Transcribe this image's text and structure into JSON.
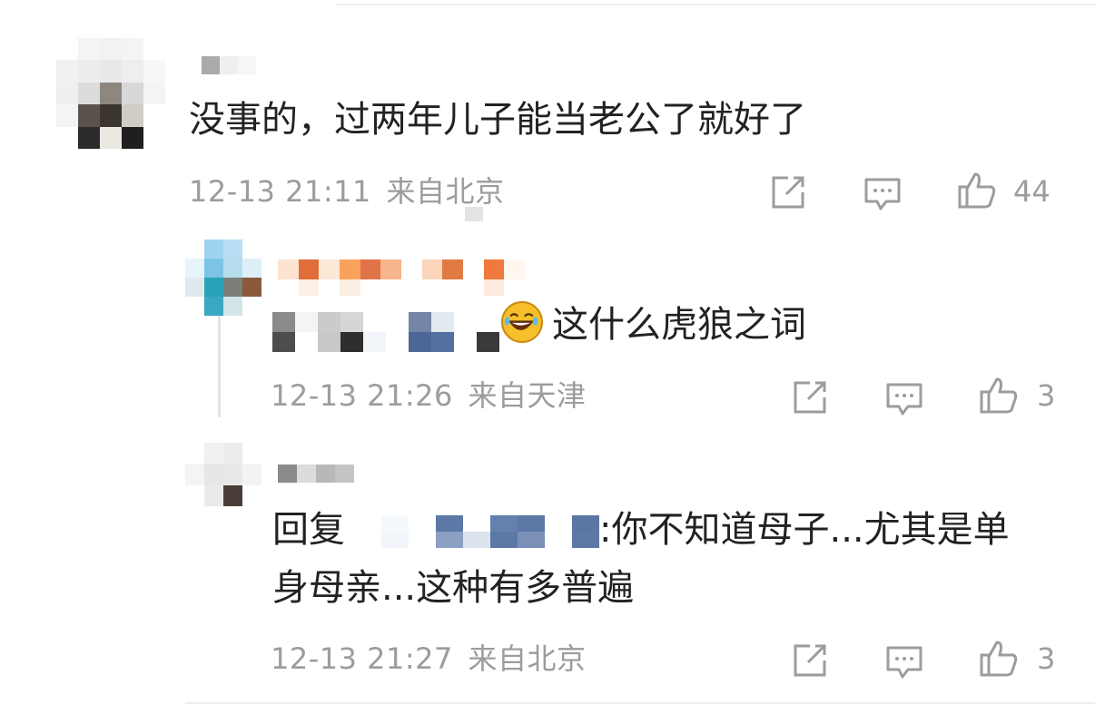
{
  "comments": [
    {
      "text": "没事的，过两年儿子能当老公了就好了",
      "time": "12-13 21:11",
      "location": "来自北京",
      "likes": "44"
    },
    {
      "text": "这什么虎狼之词",
      "time": "12-13 21:26",
      "location": "来自天津",
      "likes": "3"
    },
    {
      "reply_prefix": "回复",
      "text_line1": ":你不知道母子...尤其是单",
      "text_line2": "身母亲...这种有多普遍",
      "time": "12-13 21:27",
      "location": "来自北京",
      "likes": "3"
    }
  ],
  "icons": {
    "share": "share-icon",
    "comment": "comment-icon",
    "like": "thumbs-up-icon"
  },
  "colors": {
    "text": "#222222",
    "meta": "#9c9c9c",
    "divider": "#eeeeee"
  }
}
